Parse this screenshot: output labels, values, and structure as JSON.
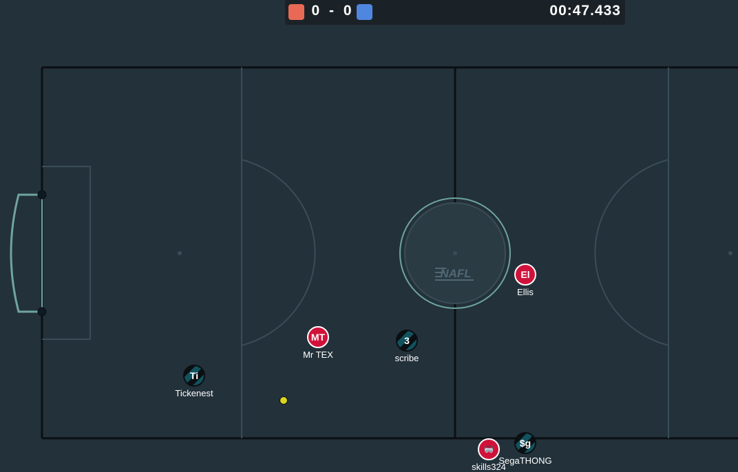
{
  "scoreboard": {
    "red_score": "0",
    "separator": "-",
    "blue_score": "0",
    "clock": "00:47.433",
    "red_color": "#e86a55",
    "blue_color": "#4f86e0"
  },
  "pitch": {
    "logo_text": "NAFL",
    "background_color": "#23313a",
    "line_color": "#3a4d57"
  },
  "players": [
    {
      "id": "p_tickenest",
      "avatar": "Ti",
      "name": "Tickenest",
      "team": "blue"
    },
    {
      "id": "p_mrtex",
      "avatar": "MT",
      "name": "Mr TEX",
      "team": "red"
    },
    {
      "id": "p_scribe",
      "avatar": "3",
      "name": "scribe",
      "team": "blue"
    },
    {
      "id": "p_ellis",
      "avatar": "El",
      "name": "Ellis",
      "team": "red"
    },
    {
      "id": "p_skills",
      "avatar": "🥽",
      "name": "skills324",
      "team": "red"
    },
    {
      "id": "p_sega",
      "avatar": "$g",
      "name": "SegaTHONG",
      "team": "blue"
    }
  ],
  "ball": {
    "color": "#d8d620"
  }
}
